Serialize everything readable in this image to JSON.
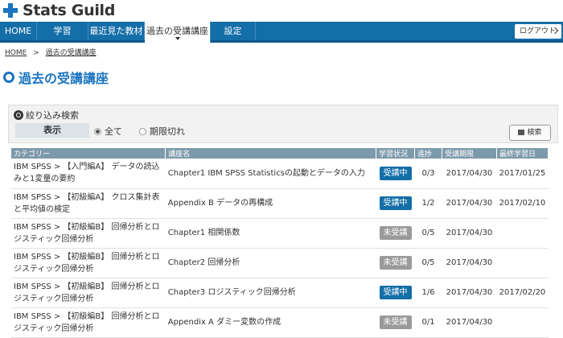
{
  "header": {
    "logo_text": "Stats Guild"
  },
  "nav": {
    "items": [
      {
        "label": "HOME"
      },
      {
        "label": "学習"
      },
      {
        "label": "最近見た教材"
      },
      {
        "label": "過去の受講講座"
      },
      {
        "label": "設定"
      }
    ],
    "logout_label": "ログアウト"
  },
  "breadcrumb": {
    "home": "HOME",
    "separator": ">",
    "current": "過去の受講講座"
  },
  "page": {
    "title": "過去の受講講座"
  },
  "filter": {
    "heading": "絞り込み検索",
    "label": "表示",
    "options": [
      {
        "label": "全て",
        "selected": true
      },
      {
        "label": "期限切れ",
        "selected": false
      }
    ],
    "search_label": "検索"
  },
  "table": {
    "headers": [
      "カテゴリー",
      "講座名",
      "学習状況",
      "進捗",
      "受講期限",
      "最終学習日"
    ],
    "rows": [
      {
        "category": "IBM SPSS > 【入門編A】 データの読込みと1変量の要約",
        "course": "Chapter1 IBM SPSS Statisticsの起動とデータの入力",
        "status": "受講中",
        "status_type": "active",
        "progress": "0/3",
        "period": "2017/04/30",
        "last": "2017/01/25"
      },
      {
        "category": "IBM SPSS > 【初級編A】 クロス集計表と平均値の検定",
        "course": "Appendix B データの再構成",
        "status": "受講中",
        "status_type": "active",
        "progress": "1/2",
        "period": "2017/04/30",
        "last": "2017/02/10"
      },
      {
        "category": "IBM SPSS > 【初級編B】 回帰分析とロジスティック回帰分析",
        "course": "Chapter1 相関係数",
        "status": "未受講",
        "status_type": "inactive",
        "progress": "0/5",
        "period": "2017/04/30",
        "last": ""
      },
      {
        "category": "IBM SPSS > 【初級編B】 回帰分析とロジスティック回帰分析",
        "course": "Chapter2 回帰分析",
        "status": "未受講",
        "status_type": "inactive",
        "progress": "0/5",
        "period": "2017/04/30",
        "last": ""
      },
      {
        "category": "IBM SPSS > 【初級編B】 回帰分析とロジスティック回帰分析",
        "course": "Chapter3 ロジスティック回帰分析",
        "status": "受講中",
        "status_type": "active",
        "progress": "1/6",
        "period": "2017/04/30",
        "last": "2017/02/20"
      },
      {
        "category": "IBM SPSS > 【初級編B】 回帰分析とロジスティック回帰分析",
        "course": "Appendix A ダミー変数の作成",
        "status": "未受講",
        "status_type": "inactive",
        "progress": "0/1",
        "period": "2017/04/30",
        "last": ""
      }
    ]
  },
  "colors": {
    "brand": "#1a74c0",
    "nav": "#146ea8",
    "badge_active": "#146ea8",
    "badge_inactive": "#9a9a9a",
    "table_header": "#7d9aab"
  }
}
